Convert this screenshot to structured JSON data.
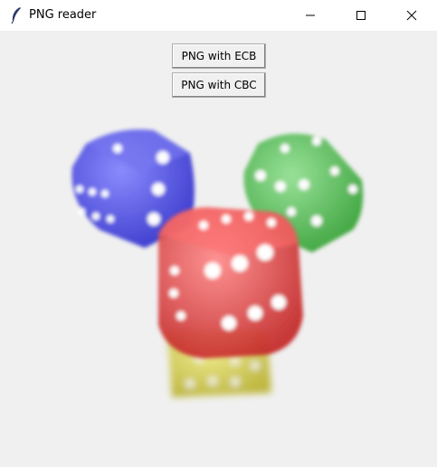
{
  "window": {
    "title": "PNG reader",
    "app_icon": "feather-icon",
    "controls": [
      "minimize-icon",
      "maximize-icon",
      "close-icon"
    ]
  },
  "buttons": {
    "ecb_label": "PNG with ECB",
    "cbc_label": "PNG with CBC"
  },
  "image": {
    "subject": "dice",
    "dice_colors": {
      "blue": "#3a3ad8",
      "green": "#3cb83c",
      "red": "#d83a3a",
      "yellow": "#c9c230"
    }
  }
}
